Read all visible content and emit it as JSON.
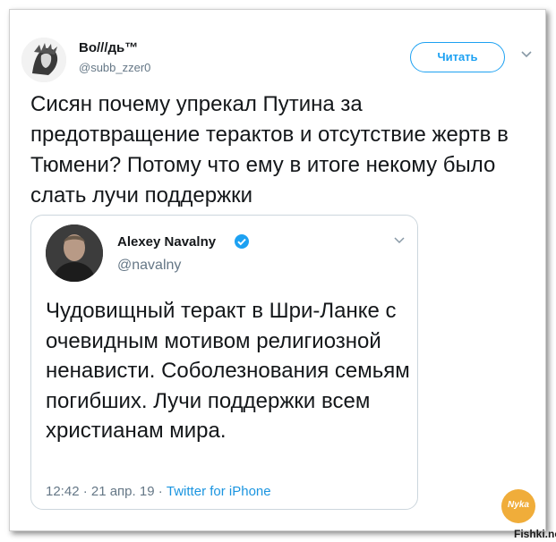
{
  "tweet": {
    "author": {
      "display_name": "Во///дь™",
      "handle": "@subb_zzer0"
    },
    "follow_label": "Читать",
    "text": "Сисян почему упрекал Путина за предотвращение терактов и отсутствие жертв в Тюмени? Потому что ему в итоге некому было слать лучи поддержки",
    "quoted": {
      "display_name": "Alexey Navalny",
      "handle": "@navalny",
      "text": "Чудовищный теракт в Шри-Ланке с очевидным мотивом религиозной ненависти. Соболезнования семьям погибших. Лучи поддержки всем христианам мира.",
      "timestamp": "12:42 · 21 апр. 19 · ",
      "source": "Twitter for iPhone"
    }
  },
  "watermark": {
    "logo_text": "Nyka",
    "site": "Fishki.net"
  },
  "icons": {
    "menu": "chevron-down-icon",
    "verified": "verified-badge-icon"
  },
  "colors": {
    "accent": "#1da1f2",
    "text": "#14171a",
    "muted": "#657786",
    "border": "#ccd6dd"
  }
}
